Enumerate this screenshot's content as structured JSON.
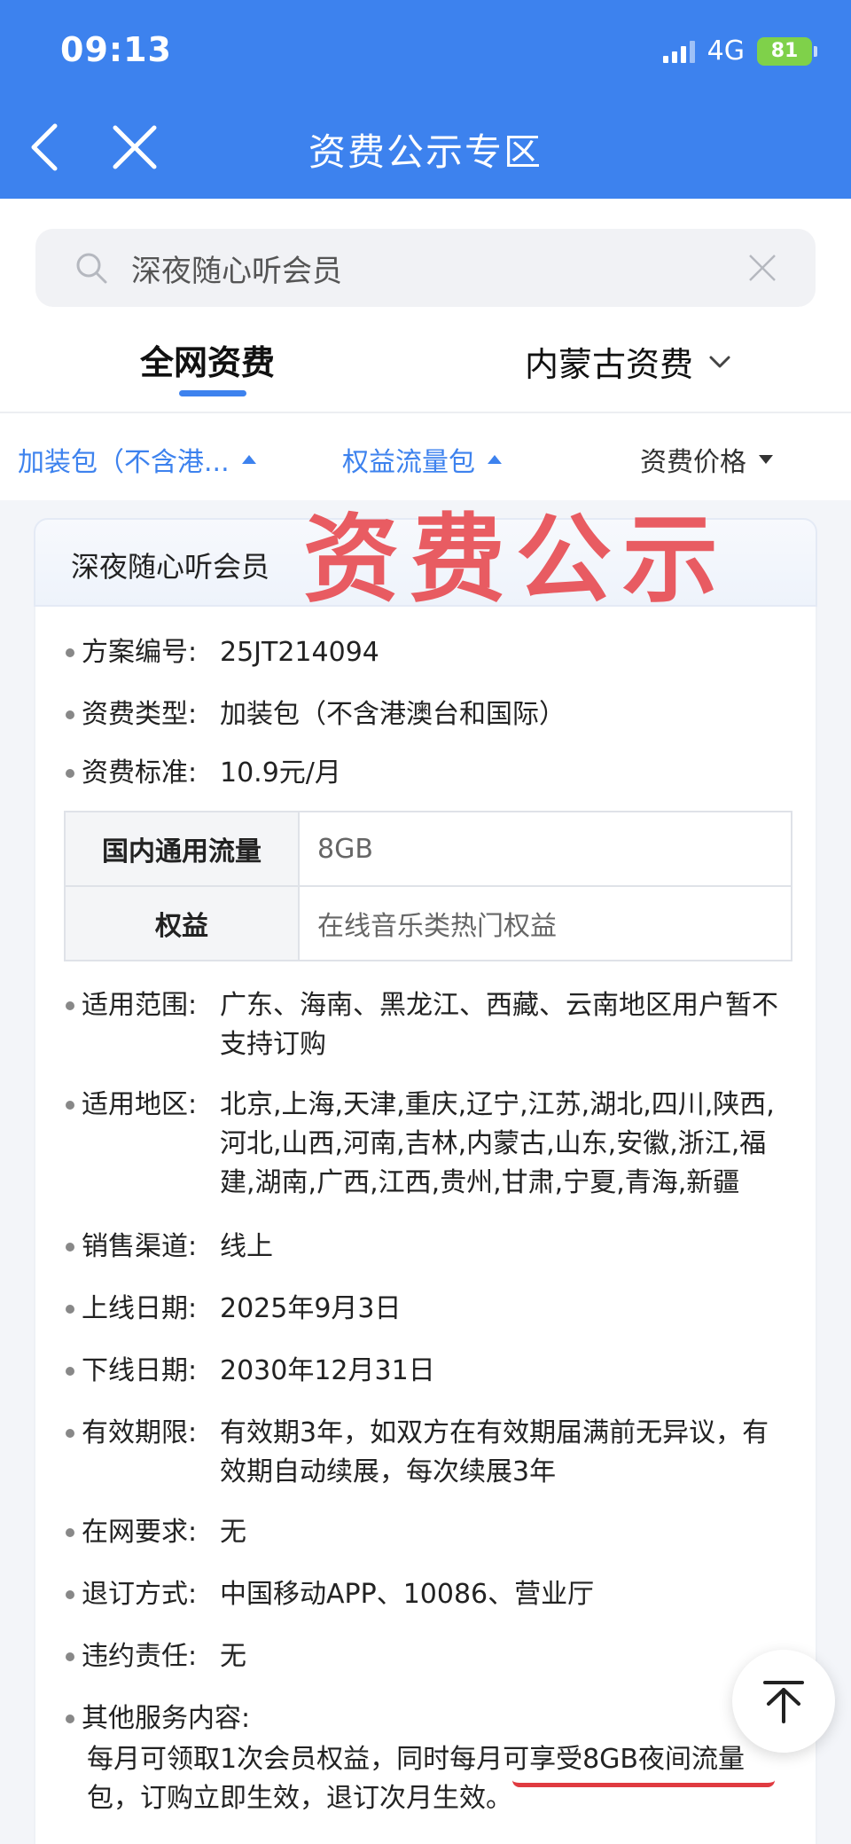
{
  "status": {
    "time": "09:13",
    "network": "4G",
    "battery": "81"
  },
  "nav": {
    "title": "资费公示专区"
  },
  "search": {
    "value": "深夜随心听会员"
  },
  "tabs": {
    "active": "全网资费",
    "region": "内蒙古资费"
  },
  "filters": [
    {
      "label": "加装包（不含港..."
    },
    {
      "label": "权益流量包"
    },
    {
      "label": "资费价格"
    }
  ],
  "card": {
    "title": "深夜随心听会员",
    "stamp": "资费公示",
    "fields": {
      "plan_no": {
        "label": "方案编号:",
        "value": "25JT214094"
      },
      "type": {
        "label": "资费类型:",
        "value": "加装包（不含港澳台和国际）"
      },
      "price": {
        "label": "资费标准:",
        "value": "10.9元/月"
      }
    },
    "specs": [
      {
        "name": "国内通用流量",
        "value": "8GB"
      },
      {
        "name": "权益",
        "value": "在线音乐类热门权益"
      }
    ],
    "details": [
      {
        "label": "适用范围:",
        "value": "广东、海南、黑龙江、西藏、云南地区用户暂不支持订购"
      },
      {
        "label": "适用地区:",
        "value": "北京,上海,天津,重庆,辽宁,江苏,湖北,四川,陕西,河北,山西,河南,吉林,内蒙古,山东,安徽,浙江,福建,湖南,广西,江西,贵州,甘肃,宁夏,青海,新疆"
      },
      {
        "label": "销售渠道:",
        "value": "线上"
      },
      {
        "label": "上线日期:",
        "value": "2025年9月3日"
      },
      {
        "label": "下线日期:",
        "value": "2030年12月31日"
      },
      {
        "label": "有效期限:",
        "value": "有效期3年，如双方在有效期届满前无异议，有效期自动续展，每次续展3年"
      },
      {
        "label": "在网要求:",
        "value": "无"
      },
      {
        "label": "退订方式:",
        "value": "中国移动APP、10086、营业厅"
      },
      {
        "label": "违约责任:",
        "value": "无"
      }
    ],
    "other": {
      "label": "其他服务内容:",
      "value": "每月可领取1次会员权益，同时每月可享受8GB夜间流量包，订购立即生效，退订次月生效。"
    }
  }
}
